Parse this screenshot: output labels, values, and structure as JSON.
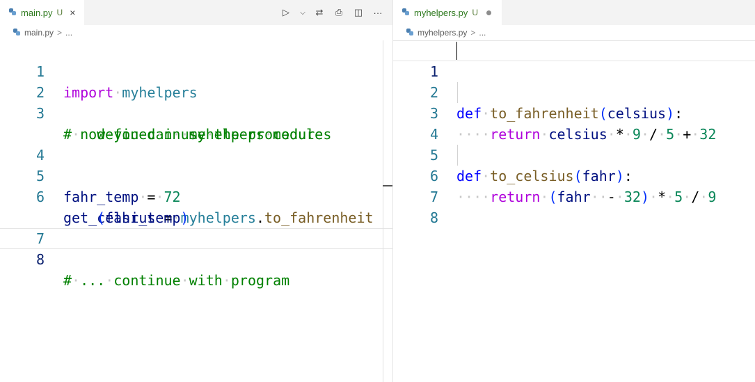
{
  "left": {
    "tab": {
      "filename": "main.py",
      "status": "U",
      "close": "×"
    },
    "breadcrumb": {
      "file": "main.py",
      "sep": ">",
      "more": "..."
    },
    "actions": {
      "run": "▷",
      "run_menu": "⌵",
      "compare": "⇄",
      "print": "⎙",
      "split": "◫",
      "more": "···"
    },
    "lines": [
      {
        "num": "1"
      },
      {
        "num": "2"
      },
      {
        "num": "3"
      },
      {
        "num": "4"
      },
      {
        "num": "5"
      },
      {
        "num": "6"
      },
      {
        "num": "7"
      },
      {
        "num": "8"
      }
    ]
  },
  "right": {
    "tab": {
      "filename": "myhelpers.py",
      "status": "U"
    },
    "breadcrumb": {
      "file": "myhelpers.py",
      "sep": ">",
      "more": "..."
    },
    "lines": [
      {
        "num": "1"
      },
      {
        "num": "2"
      },
      {
        "num": "3"
      },
      {
        "num": "4"
      },
      {
        "num": "5"
      },
      {
        "num": "6"
      },
      {
        "num": "7"
      },
      {
        "num": "8"
      }
    ]
  },
  "code": {
    "l1": {
      "kw": "import",
      "mod": "myhelpers"
    },
    "l3a": "# now you can use the procedures",
    "l3b": "defined in myhelpers module",
    "l5": {
      "var": "fahr_temp",
      "eq": "=",
      "num": "72"
    },
    "l6": {
      "var": "get_celsius",
      "eq": "=",
      "mod": "myhelpers",
      "dot": ".",
      "fn": "to_fahrenheit"
    },
    "l6b": {
      "open": "(",
      "arg": "fahr_temp",
      "close": ")"
    },
    "l8": "# ... continue with program",
    "r2": {
      "def": "def",
      "fn": "to_fahrenheit",
      "open": "(",
      "arg": "celsius",
      "close": ")",
      "colon": ":"
    },
    "r3": {
      "ret": "return",
      "var": "celsius",
      "mul": "*",
      "n9": "9",
      "div": "/",
      "n5": "5",
      "plus": "+",
      "n32": "32"
    },
    "r5": {
      "def": "def",
      "fn": "to_celsius",
      "open": "(",
      "arg": "fahr",
      "close": ")",
      "colon": ":"
    },
    "r6": {
      "ret": "return",
      "open": "(",
      "var": "fahr",
      "minus": "-",
      "n32": "32",
      "close": ")",
      "mul": "*",
      "n5": "5",
      "div": "/",
      "n9": "9"
    }
  }
}
